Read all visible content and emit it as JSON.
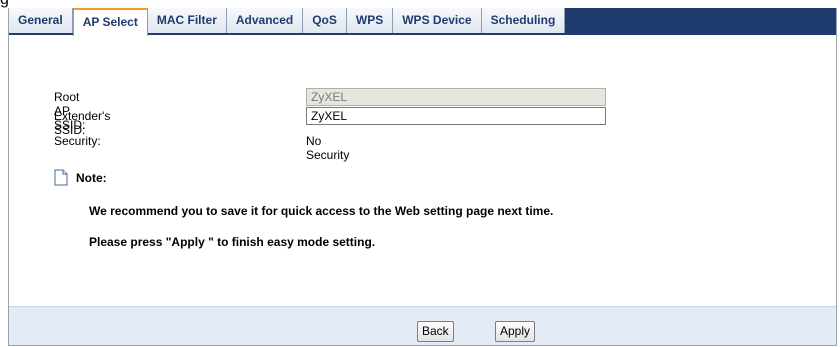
{
  "page_label": "g",
  "tabs": [
    {
      "label": "General"
    },
    {
      "label": "AP Select"
    },
    {
      "label": "MAC Filter"
    },
    {
      "label": "Advanced"
    },
    {
      "label": "QoS"
    },
    {
      "label": "WPS"
    },
    {
      "label": "WPS Device"
    },
    {
      "label": "Scheduling"
    }
  ],
  "active_tab_index": 1,
  "form": {
    "root_ap_ssid_label": "Root AP SSID:",
    "root_ap_ssid_value": "ZyXEL",
    "extender_ssid_label": "Extender's SSID:",
    "extender_ssid_value": "ZyXEL",
    "security_label": "Security:",
    "security_value": "No Security"
  },
  "note": {
    "title": "Note:",
    "line1": "We recommend you to save it for quick access to the Web setting page next time.",
    "line2": "Please press \"Apply \" to finish easy mode setting."
  },
  "buttons": {
    "back_label": "Back",
    "apply_label": "Apply"
  },
  "colors": {
    "tabbar_bg": "#1f3c6e",
    "active_tab_accent": "#f0a020",
    "footer_bg": "#e3ebf6"
  }
}
